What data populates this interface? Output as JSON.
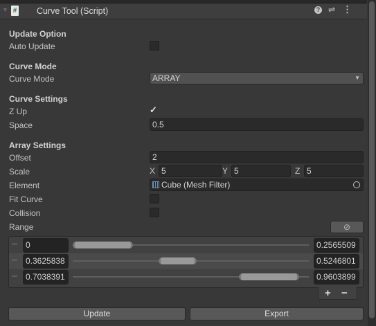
{
  "header": {
    "title": "Curve Tool (Script)",
    "script_icon": "#"
  },
  "sections": {
    "update_option": "Update Option",
    "auto_update": "Auto Update",
    "curve_mode_header": "Curve Mode",
    "curve_mode": "Curve Mode",
    "curve_mode_value": "ARRAY",
    "curve_settings": "Curve Settings",
    "z_up": "Z Up",
    "z_up_check": "✓",
    "space": "Space",
    "space_value": "0.5",
    "array_settings": "Array Settings",
    "offset": "Offset",
    "offset_value": "2",
    "scale": "Scale",
    "scale_x_label": "X",
    "scale_x": "5",
    "scale_y_label": "Y",
    "scale_y": "5",
    "scale_z_label": "Z",
    "scale_z": "5",
    "element": "Element",
    "element_value": "Cube (Mesh Filter)",
    "fit_curve": "Fit Curve",
    "collision": "Collision",
    "range": "Range"
  },
  "ranges": [
    {
      "min": "0",
      "max": "0.2565509",
      "min_v": 0,
      "max_v": 0.2565509
    },
    {
      "min": "0.3625838",
      "max": "0.5246801",
      "min_v": 0.3625838,
      "max_v": 0.5246801
    },
    {
      "min": "0.7038391",
      "max": "0.9603899",
      "min_v": 0.7038391,
      "max_v": 0.9603899
    }
  ],
  "list_buttons": {
    "add": "+",
    "remove": "−"
  },
  "buttons": {
    "update": "Update",
    "export": "Export"
  }
}
